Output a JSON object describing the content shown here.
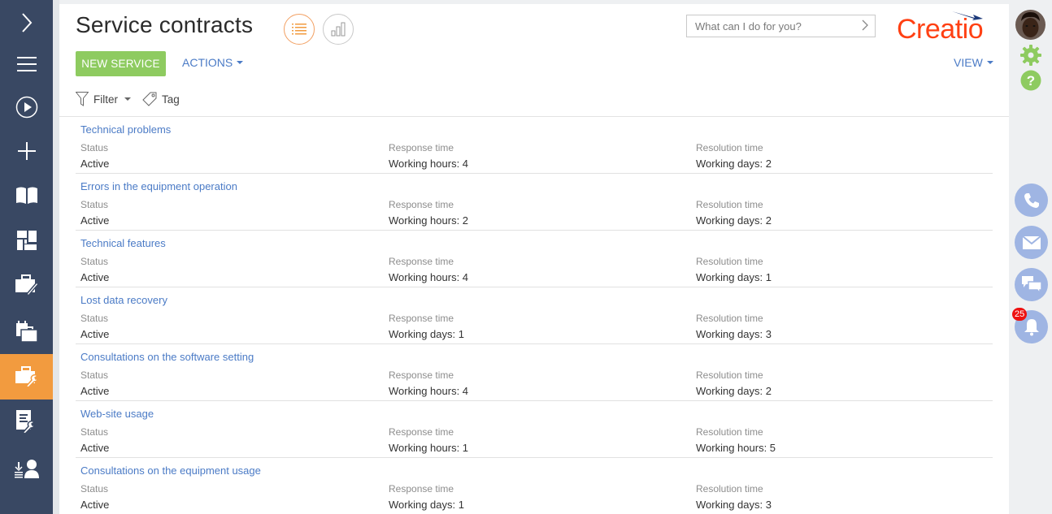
{
  "sidebar": {
    "items": [
      {
        "name": "collapse",
        "icon": "chevron-right-icon"
      },
      {
        "name": "menu",
        "icon": "hamburger-menu-icon"
      },
      {
        "name": "processes",
        "icon": "play-circle-icon"
      },
      {
        "name": "add",
        "icon": "plus-icon"
      },
      {
        "name": "knowledge-base",
        "icon": "book-icon"
      },
      {
        "name": "dashboards",
        "icon": "dashboard-tiles-icon"
      },
      {
        "name": "contracts",
        "icon": "briefcase-pen-icon"
      },
      {
        "name": "projects",
        "icon": "calendar-briefcase-icon"
      },
      {
        "name": "service-contracts",
        "icon": "briefcase-wrench-icon",
        "active": true
      },
      {
        "name": "service-catalog",
        "icon": "document-wrench-icon"
      },
      {
        "name": "agent-desktop",
        "icon": "agent-headset-icon"
      }
    ],
    "active_color": "#f29b3f",
    "bg_color": "#394863"
  },
  "header": {
    "title": "Service contracts",
    "view_list_icon": "list-view-icon",
    "view_chart_icon": "analytics-view-icon",
    "search_placeholder": "What can I do for you?",
    "logo_text": "Creatio"
  },
  "toolbar": {
    "new_label": "NEW SERVICE",
    "actions_label": "ACTIONS",
    "view_label": "VIEW",
    "filter_label": "Filter",
    "tag_label": "Tag"
  },
  "columns": {
    "status": "Status",
    "response": "Response time",
    "resolution": "Resolution time"
  },
  "rows": [
    {
      "title": "Technical problems",
      "status": "Active",
      "response": "Working hours: 4",
      "resolution": "Working days: 2"
    },
    {
      "title": "Errors in the equipment operation",
      "status": "Active",
      "response": "Working hours: 2",
      "resolution": "Working days: 2"
    },
    {
      "title": "Technical features",
      "status": "Active",
      "response": "Working hours: 4",
      "resolution": "Working days: 1"
    },
    {
      "title": "Lost data recovery",
      "status": "Active",
      "response": "Working days: 1",
      "resolution": "Working days: 3"
    },
    {
      "title": "Consultations on the software setting",
      "status": "Active",
      "response": "Working hours: 4",
      "resolution": "Working days: 2"
    },
    {
      "title": "Web-site usage",
      "status": "Active",
      "response": "Working hours: 1",
      "resolution": "Working hours: 5"
    },
    {
      "title": "Consultations on the equipment usage",
      "status": "Active",
      "response": "Working days: 1",
      "resolution": "Working days: 3"
    }
  ],
  "rail": {
    "notifications_count": "25",
    "accent_green": "#8ecb60",
    "comm_color": "#9fb5e3"
  }
}
